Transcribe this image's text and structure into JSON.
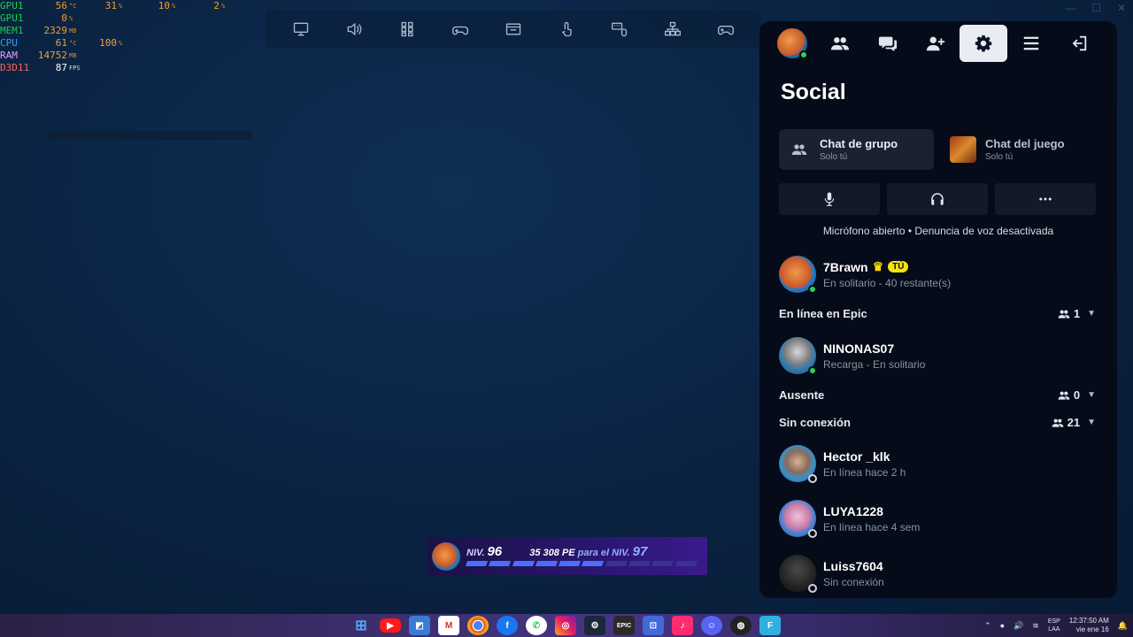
{
  "overlay": {
    "rows": [
      {
        "label": "GPU1",
        "v1": "56",
        "u1": "°C",
        "v2": "31",
        "u2": "%",
        "v3": "10",
        "u3": "%",
        "v4": "2",
        "u4": "%",
        "cls": "gpu"
      },
      {
        "label": "GPU1",
        "v1": "0",
        "u1": "%",
        "v2": "",
        "u2": "",
        "v3": "",
        "u3": "",
        "v4": "",
        "u4": "",
        "cls": "gpu"
      },
      {
        "label": "MEM1",
        "v1": "2329",
        "u1": "MB",
        "v2": "",
        "u2": "",
        "v3": "",
        "u3": "",
        "v4": "",
        "u4": "",
        "cls": "mem"
      },
      {
        "label": "CPU",
        "v1": "61",
        "u1": "°C",
        "v2": "100",
        "u2": "%",
        "v3": "",
        "u3": "",
        "v4": "",
        "u4": "",
        "cls": "cpu"
      },
      {
        "label": "RAM",
        "v1": "14752",
        "u1": "MB",
        "v2": "",
        "u2": "",
        "v3": "",
        "u3": "",
        "v4": "",
        "u4": "",
        "cls": "ram"
      },
      {
        "label": "D3D11",
        "v1": "87",
        "u1": "FPS",
        "v2": "",
        "u2": "",
        "v3": "",
        "u3": "",
        "v4": "",
        "u4": "",
        "cls": "d3d"
      }
    ]
  },
  "toolbar": {
    "icons": [
      "monitor-icon",
      "volume-icon",
      "grid-icon",
      "gamepad-touch-icon",
      "window-icon",
      "touch-icon",
      "keyboard-mouse-icon",
      "network-icon",
      "controller-icon"
    ]
  },
  "social": {
    "title": "Social",
    "chat_tabs": [
      {
        "name": "Chat de grupo",
        "sub": "Solo tú"
      },
      {
        "name": "Chat del juego",
        "sub": "Solo tú"
      }
    ],
    "voice_status": "Micrófono abierto • Denuncia de voz desactivada",
    "me": {
      "name": "7Brawn",
      "badge": "TÚ",
      "status": "En solitario - 40 restante(s)"
    },
    "sections": {
      "online": {
        "label": "En línea en Epic",
        "count": "1"
      },
      "away": {
        "label": "Ausente",
        "count": "0"
      },
      "offline": {
        "label": "Sin conexión",
        "count": "21"
      }
    },
    "friends_online": [
      {
        "name": "NINONAS07",
        "status": "Recarga - En solitario"
      }
    ],
    "friends_offline": [
      {
        "name": "Hector _klk",
        "status": "En línea hace 2 h"
      },
      {
        "name": "LUYA1228",
        "status": "En línea hace 4 sem"
      },
      {
        "name": "Luiss7604",
        "status": "Sin conexión"
      }
    ]
  },
  "level": {
    "prefix": "NIV.",
    "level": "96",
    "xp_text": "35 308 PE",
    "next_text": "para el NIV.",
    "next_level": "97",
    "progress_fraction": 0.58
  },
  "taskbar": {
    "apps": [
      "windows-start-icon",
      "youtube-icon",
      "files-icon",
      "gmail-icon",
      "chrome-icon",
      "facebook-icon",
      "whatsapp-icon",
      "instagram-icon",
      "steam-icon",
      "epic-games-icon",
      "epic-launcher-icon",
      "tiktok-icon",
      "discord-icon",
      "obs-icon",
      "fortnite-icon"
    ],
    "epic_label": "EPIC",
    "lang_top": "ESP",
    "lang_bottom": "LAA",
    "time": "12:37:50 AM",
    "date": "vie ene 16"
  }
}
